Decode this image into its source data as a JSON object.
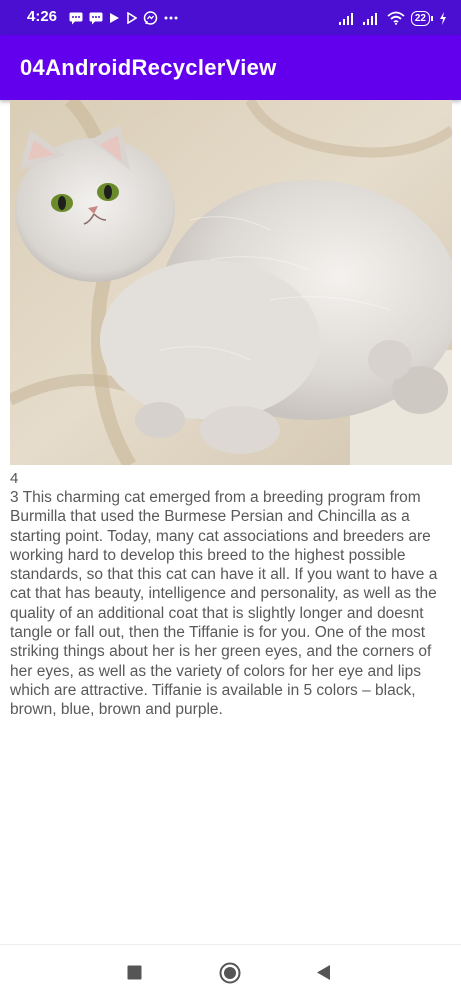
{
  "status_bar": {
    "time": "4:26",
    "battery_level": "22",
    "icons_left": [
      "message-icon",
      "message-icon",
      "play-store-icon",
      "play-icon",
      "messenger-icon",
      "more-dots-icon"
    ],
    "icons_right": [
      "cell-signal-icon",
      "cell-signal-icon",
      "wifi-icon",
      "battery-icon",
      "charging-icon"
    ]
  },
  "app_bar": {
    "title": "04AndroidRecyclerView",
    "color": "#6200ee"
  },
  "list": {
    "items": [
      {
        "image": "cat-photo",
        "number": "4",
        "description": "3 This charming cat emerged from a breeding program from Burmilla that used the Burmese Persian and Chincilla as a starting point. Today, many cat associations and breeders are working hard to develop this breed to the highest possible standards, so that this cat can have it all. If you want to have a cat that has beauty, intelligence and personality, as well as the quality of an additional coat that is slightly longer and doesnt tangle or fall out, then the Tiffanie is for you. One of the most striking things about her is her green eyes, and the corners of her eyes, as well as the variety of colors for her eye and lips which are attractive. Tiffanie is available in 5 colors – black, brown, blue, brown and purple."
      }
    ]
  },
  "nav_bar": {
    "buttons": [
      "recents-icon",
      "home-icon",
      "back-icon"
    ]
  }
}
